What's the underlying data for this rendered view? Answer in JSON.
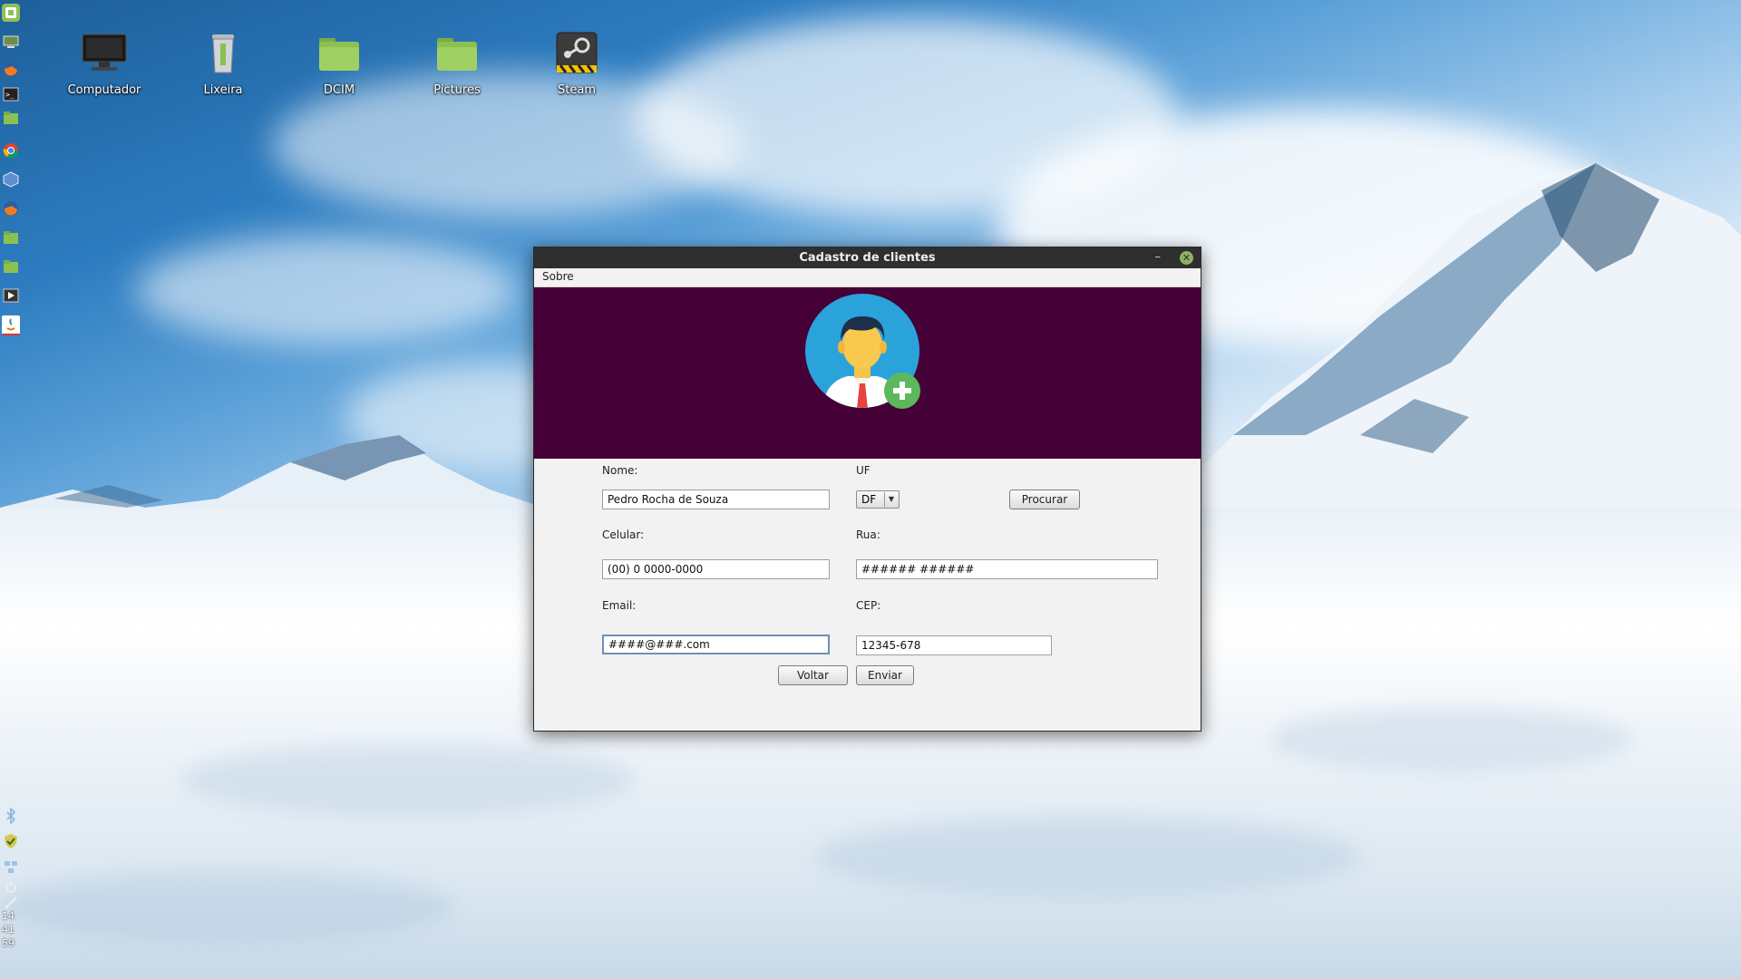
{
  "desktop": {
    "icons": [
      {
        "label": "Computador",
        "icon": "monitor-icon"
      },
      {
        "label": "Lixeira",
        "icon": "trash-icon"
      },
      {
        "label": "DCIM",
        "icon": "folder-icon"
      },
      {
        "label": "Pictures",
        "icon": "folder-icon"
      },
      {
        "label": "Steam",
        "icon": "steam-icon"
      }
    ]
  },
  "panel": {
    "launchers": [
      "mint-menu-icon",
      "show-desktop-icon",
      "firefox-icon",
      "terminal-icon",
      "folder-icon",
      "chrome-icon",
      "virtualbox-icon",
      "firefox-icon",
      "folder-icon",
      "folder-icon",
      "media-player-icon",
      "java-icon"
    ],
    "tray": [
      "bluetooth-icon",
      "update-shield-icon",
      "network-icon",
      "power-icon",
      "pen-icon"
    ],
    "clock": {
      "hours": "14",
      "minutes": "41",
      "seconds": "59"
    }
  },
  "window": {
    "title": "Cadastro de clientes",
    "menu": [
      "Sobre"
    ],
    "form": {
      "nome_label": "Nome:",
      "nome_value": "Pedro Rocha de Souza",
      "uf_label": "UF",
      "uf_value": "DF",
      "procurar_label": "Procurar",
      "celular_label": "Celular:",
      "celular_value": "(00) 0 0000-0000",
      "rua_label": "Rua:",
      "rua_value": "###### ######",
      "email_label": "Email:",
      "email_value": "####@###.com",
      "cep_label": "CEP:",
      "cep_value": "12345-678",
      "voltar_label": "Voltar",
      "enviar_label": "Enviar"
    }
  },
  "colors": {
    "banner": "#440037",
    "titlebar": "#2f2f2f",
    "window_bg": "#f2f2f2",
    "avatar_circle": "#2aa3db",
    "plus_badge": "#5cb85c"
  }
}
